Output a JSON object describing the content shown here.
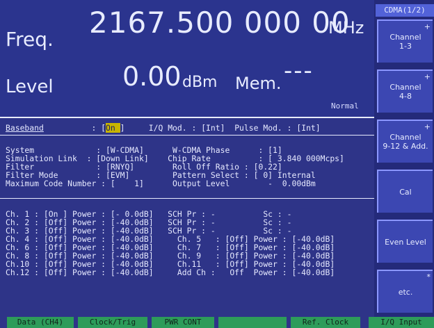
{
  "top": {
    "freq_label": "Freq.",
    "freq_value": "2167.500 000 00",
    "freq_unit": "MHz",
    "level_label": "Level",
    "level_value": "0.00",
    "level_unit": "dBm",
    "mem_label": "Mem.",
    "mem_value": "---",
    "mode": "Normal"
  },
  "baseband_row": {
    "label": "Baseband",
    "sep": "          : [",
    "value": "On ",
    "close": "]",
    "rest_a": "     I/Q Mod. : [Int]  ",
    "rest_b": "Pulse Mod. : [Int]"
  },
  "params": [
    "System             : [W-CDMA]      W-CDMA Phase      : [1]",
    "Simulation Link  : [Down Link]    Chip Rate          : [ 3.840 000Mcps]",
    "Filter             : [RNYQ]        Roll Off Ratio : [0.22]",
    "Filter Mode        : [EVM]         Pattern Select : [ 0] Internal",
    "Maximum Code Number : [    1]      Output Level        -  0.00dBm"
  ],
  "channels": [
    "Ch. 1 : [On ] Power : [- 0.0dB]   SCH Pr : -          Sc : -",
    "Ch. 2 : [Off] Power : [-40.0dB]   SCH Pr : -          Sc : -",
    "Ch. 3 : [Off] Power : [-40.0dB]   SCH Pr : -          Sc : -",
    "Ch. 4 : [Off] Power : [-40.0dB]     Ch. 5   : [Off] Power : [-40.0dB]",
    "Ch. 6 : [Off] Power : [-40.0dB]     Ch. 7   : [Off] Power : [-40.0dB]",
    "Ch. 8 : [Off] Power : [-40.0dB]     Ch. 9   : [Off] Power : [-40.0dB]",
    "Ch.10 : [Off] Power : [-40.0dB]     Ch.11   : [Off] Power : [-40.0dB]",
    "Ch.12 : [Off] Power : [-40.0dB]     Add Ch :   Off  Power : [-40.0dB]"
  ],
  "softkeys": {
    "title": "CDMA(1/2)",
    "items": [
      {
        "label": "Channel\n1-3",
        "mark": "+"
      },
      {
        "label": "Channel\n4-8",
        "mark": "+"
      },
      {
        "label": "Channel\n9-12 & Add.",
        "mark": "+"
      },
      {
        "label": "Cal",
        "mark": ""
      },
      {
        "label": "Even Level",
        "mark": ""
      },
      {
        "label": "etc.",
        "mark": "*"
      }
    ]
  },
  "tabs": [
    "Data (CH4)",
    "Clock/Trig",
    "PWR CONT",
    "",
    "Ref. Clock",
    "I/Q Input"
  ]
}
